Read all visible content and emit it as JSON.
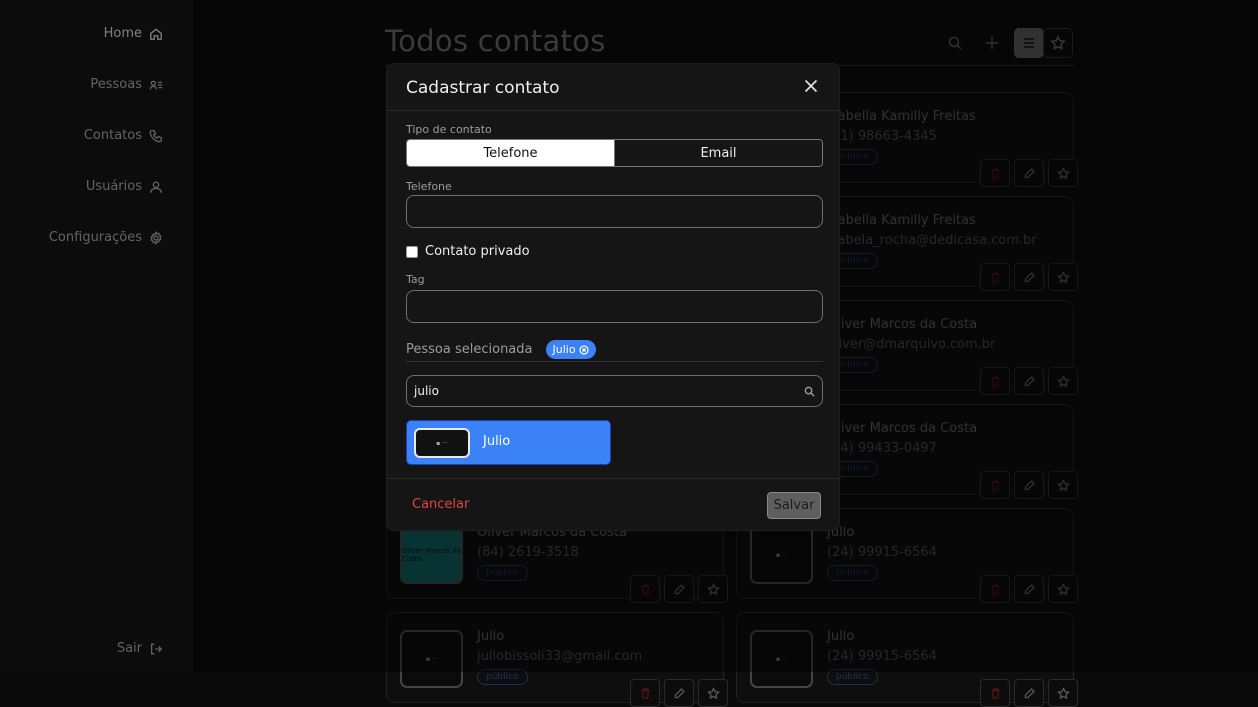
{
  "sidebar": {
    "items": [
      {
        "label": "Home",
        "icon": "home-icon"
      },
      {
        "label": "Pessoas",
        "icon": "people-list-icon"
      },
      {
        "label": "Contatos",
        "icon": "phone-icon"
      },
      {
        "label": "Usuários",
        "icon": "user-icon"
      },
      {
        "label": "Configurações",
        "icon": "gear-icon"
      }
    ],
    "logout": {
      "label": "Sair",
      "icon": "logout-icon"
    }
  },
  "page": {
    "title": "Todos contatos"
  },
  "cards": [
    {
      "name": "Isabella Kamilly Freitas",
      "info": "(11) 98663-4345",
      "badge": "público"
    },
    {
      "name": "Isabella Kamilly Freitas",
      "info": "isabela_rocha@dedicasa.com.br",
      "badge": "público"
    },
    {
      "name": "Oliver Marcos da Costa",
      "info": "oliver@dmarquivo.com.br",
      "badge": "público"
    },
    {
      "name": "Oliver Marcos da Costa",
      "info": "(84) 99433-0497",
      "badge": "público"
    },
    {
      "name": "Oliver Marcos da Costa",
      "info": "(84) 2619-3518",
      "badge": "público",
      "thumb": "Oliver Marcos da Costa"
    },
    {
      "name": "Julio",
      "info": "(24) 99915-6564",
      "badge": "público"
    },
    {
      "name": "Julio",
      "info": "juliobissoli33@gmail.com",
      "badge": "público"
    },
    {
      "name": "Julio",
      "info": "(24) 99915-6564",
      "badge": "público"
    }
  ],
  "modal": {
    "title": "Cadastrar contato",
    "type_label": "Tipo de contato",
    "type_options": [
      "Telefone",
      "Email"
    ],
    "type_selected": "Telefone",
    "phone_label": "Telefone",
    "phone_value": "",
    "private_label": "Contato privado",
    "private_checked": false,
    "tag_label": "Tag",
    "tag_value": "",
    "selected_label": "Pessoa selecionada",
    "selected_chip": "Julio",
    "search_value": "julio",
    "result_name": "Julio",
    "cancel_label": "Cancelar",
    "save_label": "Salvar"
  },
  "colors": {
    "accent": "#3b82f6",
    "danger": "#e24343"
  }
}
